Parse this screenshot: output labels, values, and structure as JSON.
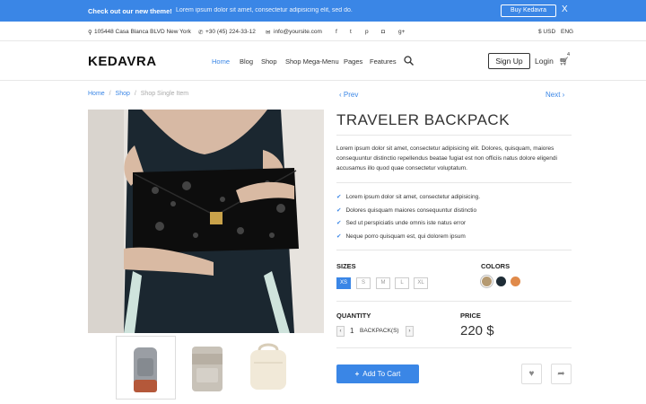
{
  "promo": {
    "bold": "Check out our new theme!",
    "text": "Lorem ipsum dolor sit amet, consectetur adipisicing elit, sed do.",
    "button": "Buy Kedavra",
    "close": "X"
  },
  "info": {
    "address": "105448 Casa Blanca BLVD New York",
    "phone": "+30 (45) 224-33-12",
    "email": "info@yoursite.com",
    "currency": "$ USD",
    "language": "ENG"
  },
  "nav": {
    "logo": "KEDAVRA",
    "items": [
      "Home",
      "Blog",
      "Shop",
      "Shop Mega-Menu",
      "Pages",
      "Features"
    ],
    "signup": "Sign Up",
    "login": "Login",
    "cart_count": "4"
  },
  "breadcrumb": {
    "home": "Home",
    "shop": "Shop",
    "current": "Shop Single Item",
    "sep": "/"
  },
  "pager": {
    "prev": "Prev",
    "next": "Next"
  },
  "product": {
    "title": "TRAVELER BACKPACK",
    "description": "Lorem ipsum dolor sit amet, consectetur adipisicing elit. Dolores, quisquam, maiores consequuntur distinctio repellendus beatae fugiat est non officiis natus dolore eligendi accusamus illo quod quae consectetur voluptatum.",
    "features": [
      "Lorem ipsum dolor sit amet, consectetur adipisicing.",
      "Dolores quisquam maiores consequuntur distinctio",
      "Sed ut perspiciatis unde omnis iste natus error",
      "Neque porro quisquam est, qui dolorem ipsum"
    ],
    "sizes_label": "SIZES",
    "sizes": [
      "XS",
      "S",
      "M",
      "L",
      "XL"
    ],
    "selected_size": "XS",
    "colors_label": "COLORS",
    "colors": [
      "#b59a72",
      "#1e2c36",
      "#e08a4a"
    ],
    "quantity_label": "QUANTITY",
    "quantity": "1",
    "unit": "BACKPACK(S)",
    "price_label": "PRICE",
    "price": "220 $",
    "add_to_cart": "Add To Cart"
  },
  "colors": {
    "accent": "#3a86e6"
  }
}
